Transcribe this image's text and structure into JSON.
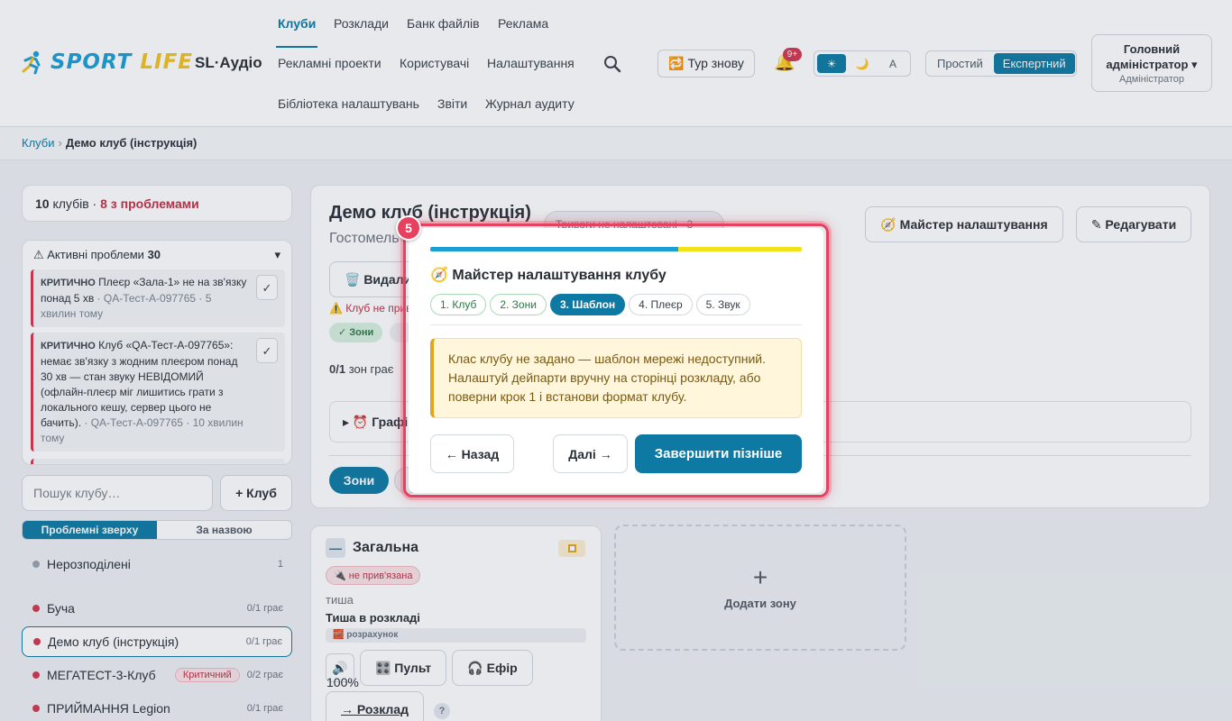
{
  "header": {
    "logo": {
      "word1": "SPORT",
      "word2": "LIFE"
    },
    "app_name": "SL·Аудіо",
    "nav": [
      {
        "label": "Клуби",
        "active": true
      },
      {
        "label": "Розклади"
      },
      {
        "label": "Банк файлів"
      },
      {
        "label": "Реклама"
      },
      {
        "label": "Рекламні проекти"
      },
      {
        "label": "Користувачі"
      },
      {
        "label": "Налаштування"
      },
      {
        "label": "Бібліотека налаштувань"
      },
      {
        "label": "Звіти"
      },
      {
        "label": "Журнал аудиту"
      }
    ],
    "tour_label": "🔁 Тур знову",
    "notifications_badge": "9+",
    "theme_options": [
      "☀",
      "🌙",
      "A"
    ],
    "mode_options": [
      "Простий",
      "Експертний"
    ],
    "user": {
      "name_line1": "Головний",
      "name_line2": "адміністратор ▾",
      "role": "Адміністратор"
    }
  },
  "breadcrumb": {
    "root": "Клуби",
    "separator": "›",
    "current": "Демо клуб (інструкція)"
  },
  "sidebar": {
    "summary": {
      "count": "10",
      "count_label": "клубів",
      "dot": "·",
      "problems": "8 з проблемами"
    },
    "active_problems": {
      "title": "⚠ Активні проблеми",
      "count": "30",
      "toggle": "▾"
    },
    "problems": [
      {
        "level": "КРИТИЧНО",
        "text": "Плеєр «Зала-1» не на зв'язку понад 5 хв",
        "meta": "· QA-Тест-А-097765 · 5 хвилин тому",
        "check": "✓"
      },
      {
        "level": "КРИТИЧНО",
        "text": "Клуб «QA-Тест-А-097765»: немає зв'язку з жодним плеєром понад 30 хв — стан звуку НЕВІДОМИЙ (офлайн-плеєр міг лишитись грати з локального кешу, сервер цього не бачить).",
        "meta": "· QA-Тест-А-097765 · 10 хвилин тому",
        "check": "✓"
      }
    ],
    "search_placeholder": "Пошук клубу…",
    "add_club_label": "+ Клуб",
    "sort_options": [
      "Проблемні зверху",
      "За назвою"
    ],
    "clubs": [
      {
        "name": "Нерозподілені",
        "status": "1",
        "dot_color": "#9aa3ad"
      },
      {
        "name": "Буча",
        "status": "0/1 грає",
        "dot_color": "#d2384f"
      },
      {
        "name": "Демо клуб (інструкція)",
        "status": "0/1 грає",
        "dot_color": "#d2384f",
        "selected": true
      },
      {
        "name": "МЕГАТЕСТ-3-Клуб",
        "status": "0/2 грає",
        "dot_color": "#d2384f",
        "badge": "Критичний"
      },
      {
        "name": "ПРИЙМАННЯ Legion",
        "status": "0/1 грає",
        "dot_color": "#d2384f"
      }
    ]
  },
  "main": {
    "club_title": "Демо клуб (інструкція)",
    "club_subtitle": "Гостомель",
    "alarm_pill": "Тривоги не налаштовані · 3",
    "wizard_button": "🧭 Майстер налаштування",
    "edit_button": "✎ Редагувати",
    "delete_button": "🗑️ Видалити",
    "warning_line": "⚠️ Клуб не прив",
    "tag_zones": "✓ Зони",
    "zones_playing_count": "0/1",
    "zones_playing_label": "зон грає",
    "schedule_title": "▸ ⏰ Графік",
    "tab_zones": "Зони",
    "zone": {
      "collapse": "—",
      "name": "Загальна",
      "unbound": "🔌 не прив'язана",
      "silence_label": "тиша",
      "silence_value": "Тиша в розкладі",
      "calc": "🧱 розрахунок",
      "volume_icon": "🔊",
      "volume": "100%",
      "pult": "🎛️ Пульт",
      "efir": "🎧 Ефір",
      "rozklad": "→ Розклад",
      "help": "?"
    },
    "add_zone": {
      "plus": "+",
      "label": "Додати зону"
    }
  },
  "wizard": {
    "step_number": "5",
    "progress": 0.668,
    "title": "🧭 Майстер налаштування клубу",
    "steps": [
      {
        "label": "1. Клуб",
        "state": "done"
      },
      {
        "label": "2. Зони",
        "state": "done"
      },
      {
        "label": "3. Шаблон",
        "state": "current"
      },
      {
        "label": "4. Плеєр",
        "state": "todo"
      },
      {
        "label": "5. Звук",
        "state": "todo"
      }
    ],
    "alert": "Клас клубу не задано — шаблон мережі недоступний. Налаштуй дейпарти вручну на сторінці розкладу, або поверни крок 1 і встанови формат клубу.",
    "back": "← Назад",
    "next": "Далі →",
    "finish": "Завершити пізніше"
  },
  "colors": {
    "accent": "#0e7aa3",
    "critical": "#d2384f",
    "highlight": "#e8405f",
    "warning_bg": "#fff6dc"
  }
}
